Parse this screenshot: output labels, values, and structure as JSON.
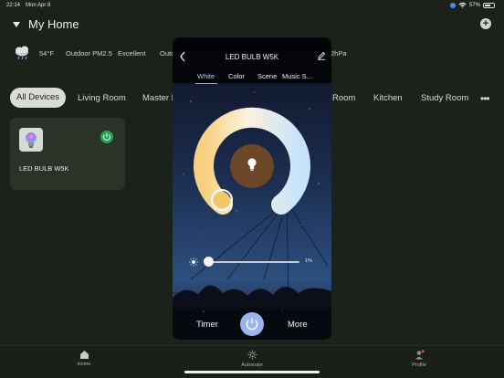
{
  "status_bar": {
    "time": "22:14",
    "date": "Mon Apr 8",
    "battery": "57%"
  },
  "home": {
    "title": "My Home"
  },
  "weather": {
    "temperature": "54°F",
    "pm_label": "Outdoor PM2.5",
    "pm_value": "Excellent",
    "humidity_label_partial": "Outd",
    "pressure_partial": "2hPa",
    "icon": "cloud-rain-icon"
  },
  "room_tabs": {
    "active": "All Devices",
    "items": [
      "Living Room",
      "Master B",
      "Room",
      "Kitchen",
      "Study Room"
    ]
  },
  "device": {
    "name": "LED BULB W5K",
    "status_color": "#27a05a"
  },
  "modal": {
    "title": "LED BULB W5K",
    "tabs": [
      "White",
      "Color",
      "Scene",
      "Music S..."
    ],
    "active_tab": "White",
    "brightness": 1,
    "brightness_label": "1%",
    "timer_label": "Timer",
    "more_label": "More",
    "accent_color": "#9bb4ee"
  },
  "bottom_nav": [
    {
      "label": "Home",
      "icon": "home-icon"
    },
    {
      "label": "Automate",
      "icon": "automate-icon"
    },
    {
      "label": "Profile",
      "icon": "profile-icon"
    }
  ]
}
